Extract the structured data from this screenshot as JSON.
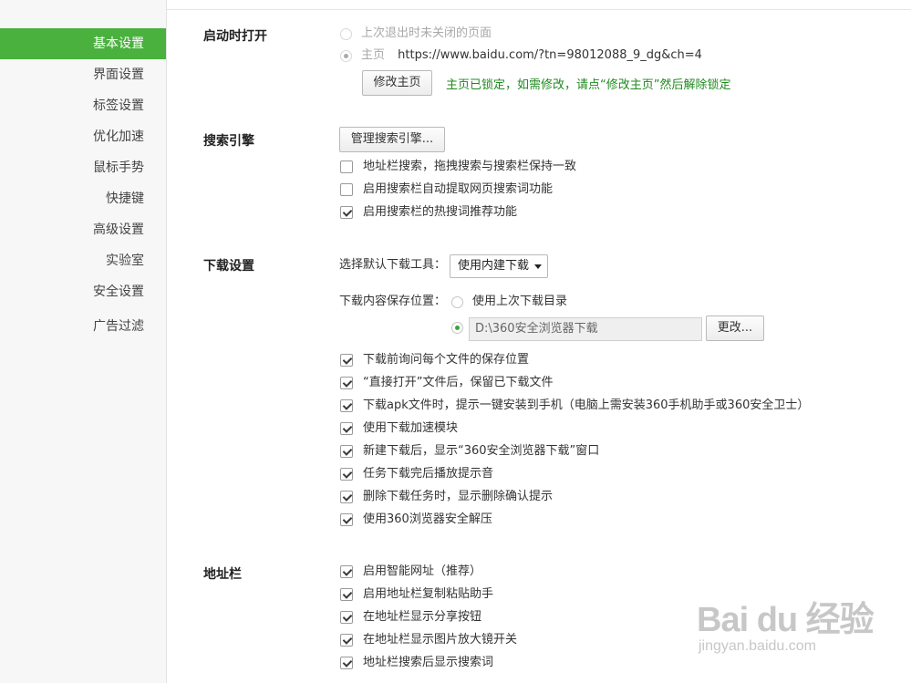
{
  "sidebar": {
    "items": [
      {
        "label": "基本设置"
      },
      {
        "label": "界面设置"
      },
      {
        "label": "标签设置"
      },
      {
        "label": "优化加速"
      },
      {
        "label": "鼠标手势"
      },
      {
        "label": "快捷键"
      },
      {
        "label": "高级设置"
      },
      {
        "label": "实验室"
      },
      {
        "label": "安全设置"
      },
      {
        "label": "广告过滤"
      }
    ],
    "active_index": 0
  },
  "startup": {
    "title": "启动时打开",
    "option_restore": "上次退出时未关闭的页面",
    "option_home": "主页",
    "home_url": "https://www.baidu.com/?tn=98012088_9_dg&ch=4",
    "modify_button": "修改主页",
    "lock_note": "主页已锁定，如需修改，请点“修改主页”然后解除锁定"
  },
  "search": {
    "title": "搜索引擎",
    "manage_button": "管理搜索引擎...",
    "options": [
      {
        "label": "地址栏搜索，拖拽搜索与搜索栏保持一致",
        "checked": false
      },
      {
        "label": "启用搜索栏自动提取网页搜索词功能",
        "checked": false
      },
      {
        "label": "启用搜索栏的热搜词推荐功能",
        "checked": true
      }
    ]
  },
  "download": {
    "title": "下载设置",
    "tool_label": "选择默认下载工具：",
    "tool_value": "使用内建下载",
    "location_label": "下载内容保存位置：",
    "use_last_dir": "使用上次下载目录",
    "path_value": "D:\\360安全浏览器下载",
    "change_button": "更改...",
    "options": [
      {
        "label": "下载前询问每个文件的保存位置",
        "checked": true
      },
      {
        "label": "“直接打开”文件后，保留已下载文件",
        "checked": true
      },
      {
        "label": "下载apk文件时，提示一键安装到手机（电脑上需安装360手机助手或360安全卫士）",
        "checked": true
      },
      {
        "label": "使用下载加速模块",
        "checked": true
      },
      {
        "label": "新建下载后，显示“360安全浏览器下载”窗口",
        "checked": true
      },
      {
        "label": "任务下载完后播放提示音",
        "checked": true
      },
      {
        "label": "删除下载任务时，显示删除确认提示",
        "checked": true
      },
      {
        "label": "使用360浏览器安全解压",
        "checked": true
      }
    ]
  },
  "addressbar": {
    "title": "地址栏",
    "options": [
      {
        "label": "启用智能网址（推荐）",
        "checked": true
      },
      {
        "label": "启用地址栏复制粘贴助手",
        "checked": true
      },
      {
        "label": "在地址栏显示分享按钮",
        "checked": true
      },
      {
        "label": "在地址栏显示图片放大镜开关",
        "checked": true
      },
      {
        "label": "地址栏搜索后显示搜索词",
        "checked": true
      }
    ]
  },
  "watermark": {
    "brand": "Bai du 经验",
    "url": "jingyan.baidu.com"
  },
  "colors": {
    "accent": "#4ab13f",
    "note_green": "#1f8a1f"
  }
}
